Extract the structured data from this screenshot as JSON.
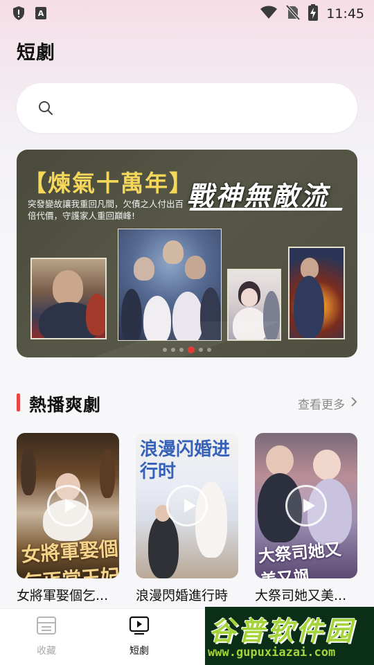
{
  "status_bar": {
    "time": "11:45",
    "left_icons": [
      "shield-icon",
      "a-badge-icon"
    ],
    "right_icons": [
      "wifi-icon",
      "no-sim-icon",
      "battery-charging-icon"
    ]
  },
  "header": {
    "title": "短劇"
  },
  "search": {
    "placeholder": "",
    "value": ""
  },
  "banner": {
    "title": "【煉氣十萬年】",
    "subtitle": "突發變故讓我重回凡間，欠債之人付出百倍代價，守護家人重回巔峰!",
    "brand": "戰神無敵流",
    "pagination": {
      "count": 6,
      "active_index": 3
    }
  },
  "section": {
    "title": "熱播爽劇",
    "more_label": "查看更多"
  },
  "cards": [
    {
      "title": "女將軍娶個乞...",
      "poster_text": "女將軍娶個乞丐當王妃"
    },
    {
      "title": "浪漫閃婚進行時",
      "poster_text": "浪漫闪婚进行时"
    },
    {
      "title": "大祭司她又美...",
      "poster_text": "大祭司她又美又飒"
    }
  ],
  "bottom_nav": [
    {
      "label": "收藏",
      "icon": "list-icon",
      "active": false
    },
    {
      "label": "短劇",
      "icon": "tv-play-icon",
      "active": true
    }
  ],
  "watermark": {
    "top": "谷普软件园",
    "bottom": "www.gupuxiazai.com"
  },
  "colors": {
    "accent_red": "#e64747",
    "active_dot": "#e0312e",
    "banner_title_yellow": "#f5d85a",
    "watermark_green": "#a4d43a"
  }
}
